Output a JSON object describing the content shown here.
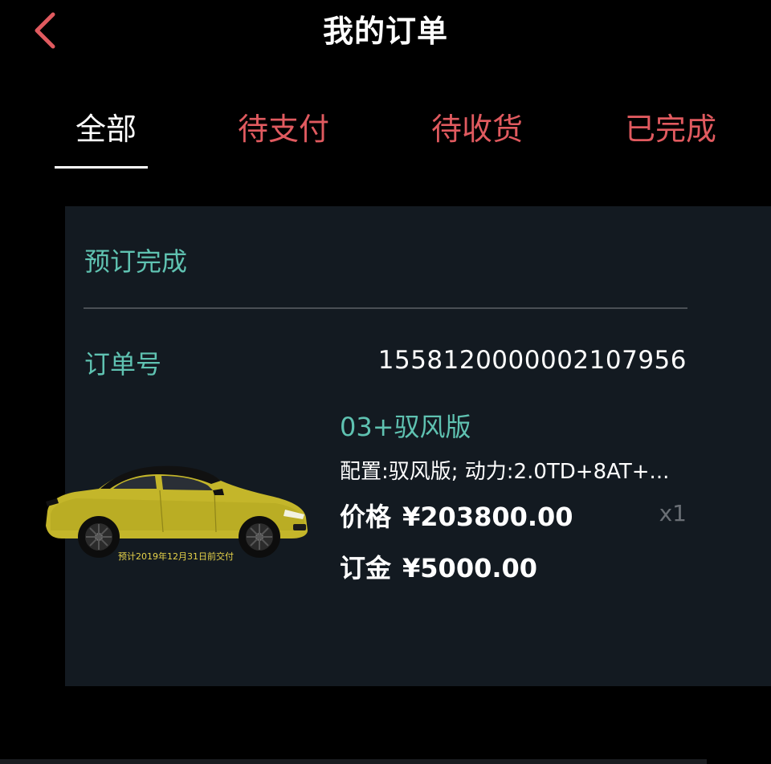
{
  "header": {
    "title": "我的订单",
    "back_icon": "chevron-left-icon",
    "accent_color": "#e05a5f"
  },
  "tabs": [
    {
      "label": "全部",
      "active": true
    },
    {
      "label": "待支付",
      "active": false
    },
    {
      "label": "待收货",
      "active": false
    },
    {
      "label": "已完成",
      "active": false
    }
  ],
  "order": {
    "status": "预订完成",
    "number_label": "订单号",
    "number": "1558120000002107956",
    "image_caption": "预计2019年12月31日前交付",
    "product_name": "03+驭风版",
    "config": "配置:驭风版; 动力:2.0TD+8AT+...",
    "price_label": "价格",
    "price": "¥203800.00",
    "quantity": "x1",
    "deposit_label": "订金",
    "deposit": "¥5000.00",
    "status_color": "#5fc2b1"
  }
}
